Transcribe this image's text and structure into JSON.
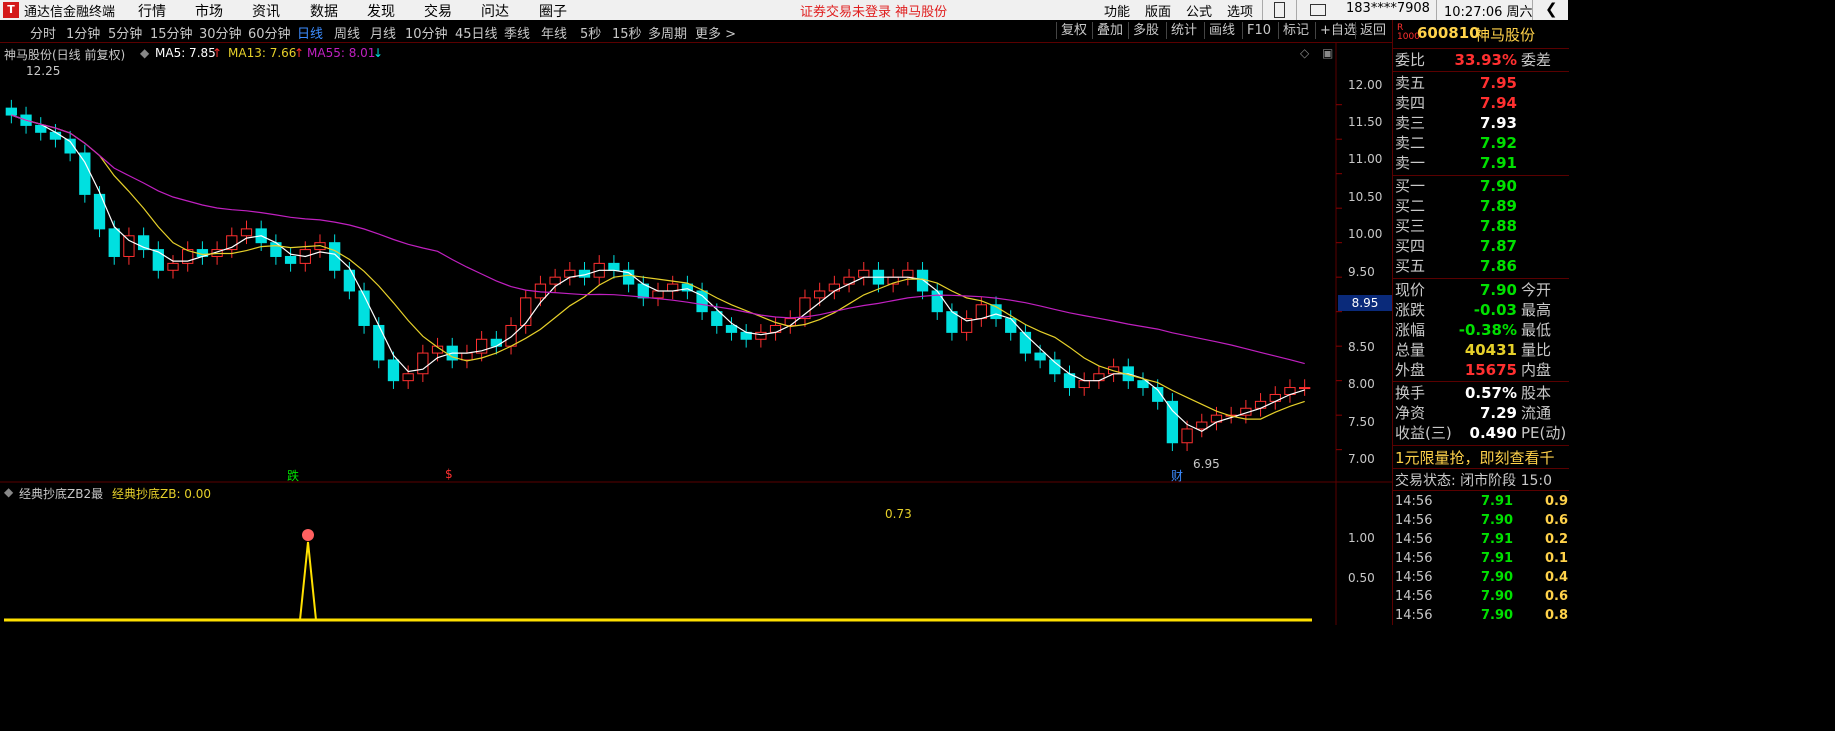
{
  "titlebar": {
    "app": "通达信金融终端",
    "menus": [
      "行情",
      "市场",
      "资讯",
      "数据",
      "发现",
      "交易",
      "问达",
      "圈子"
    ],
    "warning": "证券交易未登录  神马股份",
    "right_menus": [
      "功能",
      "版面",
      "公式",
      "选项"
    ],
    "phone": "183****7908",
    "time": "10:27:06 周六"
  },
  "periods": [
    "分时",
    "1分钟",
    "5分钟",
    "15分钟",
    "30分钟",
    "60分钟",
    "日线",
    "周线",
    "月线",
    "10分钟",
    "45日线",
    "季线",
    "年线",
    "5秒",
    "15秒",
    "多周期",
    "更多 >"
  ],
  "active_period": "日线",
  "right_buttons": [
    "复权",
    "叠加",
    "多股",
    "统计",
    "画线",
    "F10",
    "标记",
    "+自选",
    "返回"
  ],
  "legend": {
    "name": "神马股份(日线 前复权)",
    "ma5": "MA5: 7.85",
    "ma13": "MA13: 7.66",
    "ma55": "MA55: 8.01",
    "high": "12.25",
    "low": "6.95",
    "marker1": "跌",
    "marker2": "$",
    "marker3": "财",
    "price_box": "8.95"
  },
  "yaxis": [
    "12.00",
    "11.50",
    "11.00",
    "10.50",
    "10.00",
    "9.50",
    "9.00",
    "8.50",
    "8.00",
    "7.50",
    "7.00"
  ],
  "indicator": {
    "title": "经典抄底ZB2最",
    "value": "经典抄底ZB: 0.00",
    "label": "0.73",
    "yaxis": [
      "1.00",
      "0.50"
    ]
  },
  "colors": {
    "up": "#ff3030",
    "down": "#00e0e0",
    "ma5": "#ffffff",
    "ma13": "#e6d02a",
    "ma55": "#c020c0",
    "accent": "#3c8cff"
  },
  "panel": {
    "code": "600810",
    "name": "神马股份",
    "weibi_label": "委比",
    "weibi_value": "33.93%",
    "weicha_label": "委差",
    "sells": [
      {
        "label": "卖五",
        "price": "7.95",
        "color": "#ff3030"
      },
      {
        "label": "卖四",
        "price": "7.94",
        "color": "#ff3030"
      },
      {
        "label": "卖三",
        "price": "7.93",
        "color": "#ffffff"
      },
      {
        "label": "卖二",
        "price": "7.92",
        "color": "#00e000"
      },
      {
        "label": "卖一",
        "price": "7.91",
        "color": "#00e000"
      }
    ],
    "buys": [
      {
        "label": "买一",
        "price": "7.90",
        "color": "#00e000"
      },
      {
        "label": "买二",
        "price": "7.89",
        "color": "#00e000"
      },
      {
        "label": "买三",
        "price": "7.88",
        "color": "#00e000"
      },
      {
        "label": "买四",
        "price": "7.87",
        "color": "#00e000"
      },
      {
        "label": "买五",
        "price": "7.86",
        "color": "#00e000"
      }
    ],
    "stats": [
      {
        "label": "现价",
        "value": "7.90",
        "color": "#00e000",
        "label2": "今开"
      },
      {
        "label": "涨跌",
        "value": "-0.03",
        "color": "#00e000",
        "label2": "最高"
      },
      {
        "label": "涨幅",
        "value": "-0.38%",
        "color": "#00e000",
        "label2": "最低"
      },
      {
        "label": "总量",
        "value": "40431",
        "color": "#e6d02a",
        "label2": "量比"
      },
      {
        "label": "外盘",
        "value": "15675",
        "color": "#ff3030",
        "label2": "内盘"
      }
    ],
    "stats2": [
      {
        "label": "换手",
        "value": "0.57%",
        "color": "#ffffff",
        "label2": "股本"
      },
      {
        "label": "净资",
        "value": "7.29",
        "color": "#ffffff",
        "label2": "流通"
      },
      {
        "label": "收益(三)",
        "value": "0.490",
        "color": "#ffffff",
        "label2": "PE(动)"
      }
    ],
    "promo": "1元限量抢，即刻查看千",
    "trade_state": "交易状态: 闭市阶段 15:0",
    "ticks": [
      {
        "time": "14:56",
        "price": "7.91",
        "vol": "0.9"
      },
      {
        "time": "14:56",
        "price": "7.90",
        "vol": "0.6"
      },
      {
        "time": "14:56",
        "price": "7.91",
        "vol": "0.2"
      },
      {
        "time": "14:56",
        "price": "7.91",
        "vol": "0.1"
      },
      {
        "time": "14:56",
        "price": "7.90",
        "vol": "0.4"
      },
      {
        "time": "14:56",
        "price": "7.90",
        "vol": "0.6"
      },
      {
        "time": "14:56",
        "price": "7.90",
        "vol": "0.8"
      }
    ]
  },
  "chart_data": {
    "type": "line",
    "title": "神马股份(日线 前复权)",
    "ylim": [
      6.85,
      12.3
    ],
    "series": [
      {
        "name": "MA5: 7.85",
        "color": "#ffffff"
      },
      {
        "name": "MA13: 7.66",
        "color": "#e6d02a"
      },
      {
        "name": "MA55: 8.01",
        "color": "#c020c0"
      }
    ],
    "closes": [
      11.85,
      11.7,
      11.6,
      11.5,
      11.3,
      10.7,
      10.2,
      9.8,
      10.1,
      9.9,
      9.6,
      9.7,
      9.9,
      9.8,
      9.9,
      10.1,
      10.2,
      10.0,
      9.8,
      9.7,
      9.9,
      10.0,
      9.6,
      9.3,
      8.8,
      8.3,
      8.0,
      8.1,
      8.4,
      8.5,
      8.3,
      8.4,
      8.6,
      8.5,
      8.8,
      9.2,
      9.4,
      9.5,
      9.6,
      9.5,
      9.7,
      9.6,
      9.4,
      9.2,
      9.3,
      9.4,
      9.3,
      9.0,
      8.8,
      8.7,
      8.6,
      8.7,
      8.8,
      8.9,
      9.2,
      9.3,
      9.4,
      9.5,
      9.6,
      9.4,
      9.5,
      9.6,
      9.3,
      9.0,
      8.7,
      8.9,
      9.1,
      8.9,
      8.7,
      8.4,
      8.3,
      8.1,
      7.9,
      8.0,
      8.1,
      8.2,
      8.0,
      7.9,
      7.7,
      7.1,
      7.3,
      7.4,
      7.5,
      7.5,
      7.6,
      7.7,
      7.8,
      7.9,
      7.9
    ]
  }
}
